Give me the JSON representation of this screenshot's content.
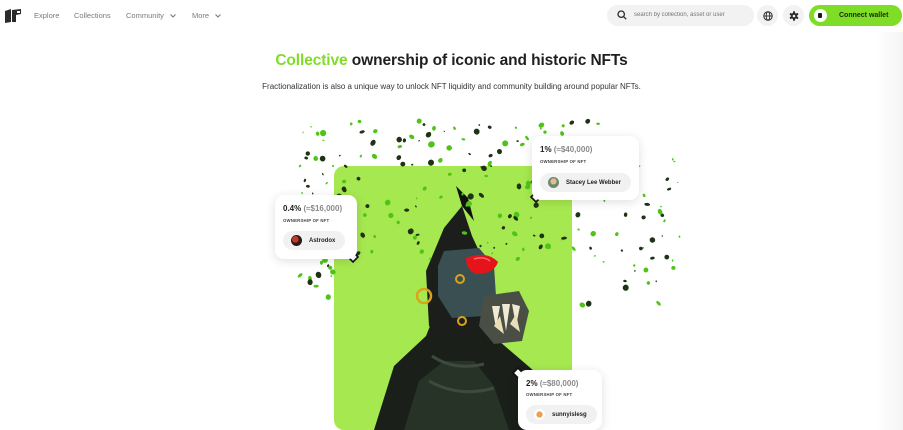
{
  "nav": {
    "links": [
      "Explore",
      "Collections",
      "Community",
      "More"
    ],
    "search_placeholder": "search by collection, asset or user",
    "connect_label": "Connect wallet"
  },
  "hero": {
    "headline_accent": "Collective",
    "headline_rest": " ownership of iconic and historic NFTs",
    "subline": "Fractionalization is also a unique way to unlock NFT liquidity and community building around popular NFTs."
  },
  "cards": [
    {
      "percent": "0.4%",
      "usd": "(≈$16,000)",
      "ownership_label": "OWNERSHIP OF NFT",
      "user": "Astrodox",
      "percent_value": 0.4
    },
    {
      "percent": "1%",
      "usd": "(≈$40,000)",
      "ownership_label": "OWNERSHIP OF NFT",
      "user": "Stacey Lee Webber",
      "percent_value": 1
    },
    {
      "percent": "2%",
      "usd": "(≈$80,000)",
      "ownership_label": "OWNERSHIP OF NFT",
      "user": "sunnyislesg",
      "percent_value": 2
    }
  ],
  "colors": {
    "accent": "#7fdd27",
    "art_background": "#a6e84f",
    "confetti_green": "#4fc417",
    "confetti_dark": "#1e3315",
    "eye_red": "#e5141b"
  },
  "icons": [
    "logo-icon",
    "chevron-down-icon",
    "search-icon",
    "globe-icon",
    "gear-icon",
    "wallet-icon"
  ]
}
